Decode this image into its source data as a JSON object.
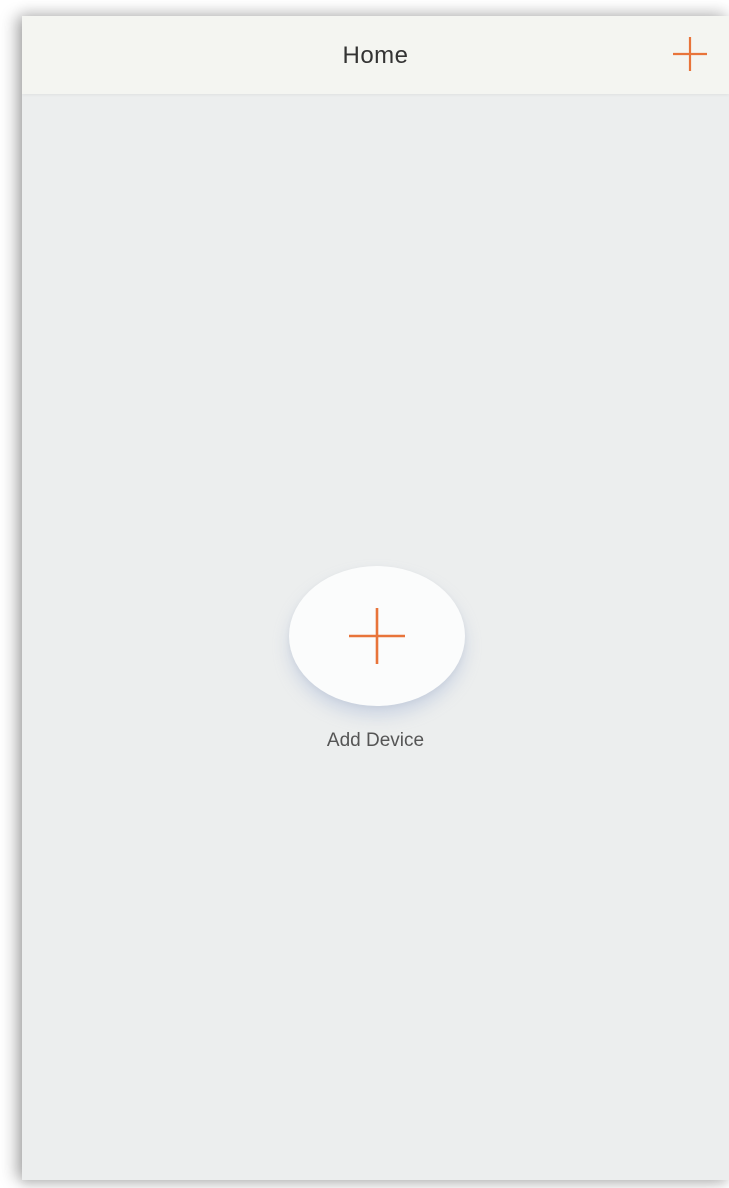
{
  "header": {
    "title": "Home",
    "add_icon": "plus-icon"
  },
  "main": {
    "add_device_label": "Add Device",
    "add_device_icon": "plus-icon"
  },
  "colors": {
    "accent": "#e8743a",
    "background": "#eceeee",
    "header_background": "#f4f5f1",
    "title_text": "#333333",
    "label_text": "#555555"
  }
}
